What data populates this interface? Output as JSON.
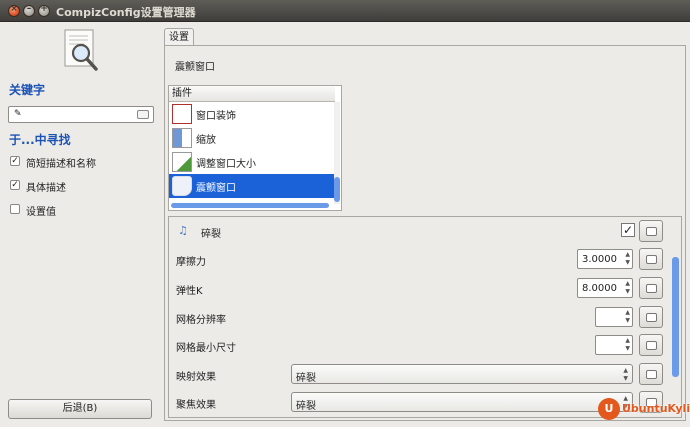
{
  "window": {
    "title": "CompizConfig设置管理器",
    "close_glyph": "×",
    "min_glyph": "–",
    "max_glyph": "+"
  },
  "left": {
    "keyword_heading": "关键字",
    "search_value": "",
    "search_in_heading": "于...中寻找",
    "options": [
      {
        "label": "简短描述和名称",
        "checked": true
      },
      {
        "label": "具体描述",
        "checked": true
      },
      {
        "label": "设置值",
        "checked": false
      }
    ],
    "back_button": "后退(B)"
  },
  "right": {
    "tab_label": "设置",
    "plugin_title": "震颤窗口",
    "plugin_list_header": "插件",
    "plugins": [
      {
        "label": "窗口装饰",
        "icon": "window-decoration-icon",
        "selected": false
      },
      {
        "label": "缩放",
        "icon": "zoom-icon",
        "selected": false
      },
      {
        "label": "调整窗口大小",
        "icon": "resize-icon",
        "selected": false
      },
      {
        "label": "震颤窗口",
        "icon": "wobbly-icon",
        "selected": true
      }
    ],
    "settings": [
      {
        "label": "碎裂",
        "type": "checkbox",
        "checked": true
      },
      {
        "label": "摩擦力",
        "type": "spin",
        "value": "3.0000"
      },
      {
        "label": "弹性K",
        "type": "spin",
        "value": "8.0000"
      },
      {
        "label": "网格分辨率",
        "type": "spin",
        "value": ""
      },
      {
        "label": "网格最小尺寸",
        "type": "spin",
        "value": ""
      },
      {
        "label": "映射效果",
        "type": "combo",
        "value": "碎裂"
      },
      {
        "label": "聚焦效果",
        "type": "combo",
        "value": "碎裂"
      }
    ],
    "check_glyph": "✓",
    "arrow_up": "▲",
    "arrow_down": "▼"
  },
  "brand": {
    "text": "UbuntuKylin",
    "glyph": "U"
  },
  "colors": {
    "accent": "#1c53b4",
    "selection": "#1b62d8",
    "brand": "#e2581d"
  }
}
